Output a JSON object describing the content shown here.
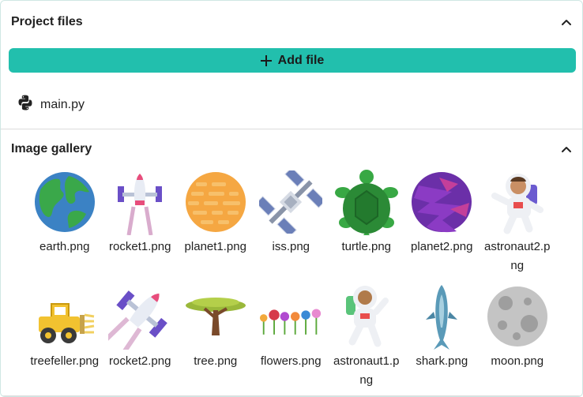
{
  "project_files": {
    "title": "Project files",
    "add_button_label": "Add file",
    "files": [
      {
        "name": "main.py",
        "icon": "python-icon"
      }
    ]
  },
  "image_gallery": {
    "title": "Image gallery",
    "images": [
      {
        "label": "earth.png",
        "icon": "earth-image"
      },
      {
        "label": "rocket1.png",
        "icon": "rocket1-image"
      },
      {
        "label": "planet1.png",
        "icon": "planet1-image"
      },
      {
        "label": "iss.png",
        "icon": "iss-image"
      },
      {
        "label": "turtle.png",
        "icon": "turtle-image"
      },
      {
        "label": "planet2.png",
        "icon": "planet2-image"
      },
      {
        "label": "astronaut2.png",
        "icon": "astronaut2-image"
      },
      {
        "label": "treefeller.png",
        "icon": "treefeller-image"
      },
      {
        "label": "rocket2.png",
        "icon": "rocket2-image"
      },
      {
        "label": "tree.png",
        "icon": "tree-image"
      },
      {
        "label": "flowers.png",
        "icon": "flowers-image"
      },
      {
        "label": "astronaut1.png",
        "icon": "astronaut1-image"
      },
      {
        "label": "shark.png",
        "icon": "shark-image"
      },
      {
        "label": "moon.png",
        "icon": "moon-image"
      }
    ]
  },
  "colors": {
    "accent": "#22bfad",
    "divider": "#dcdcdc"
  }
}
